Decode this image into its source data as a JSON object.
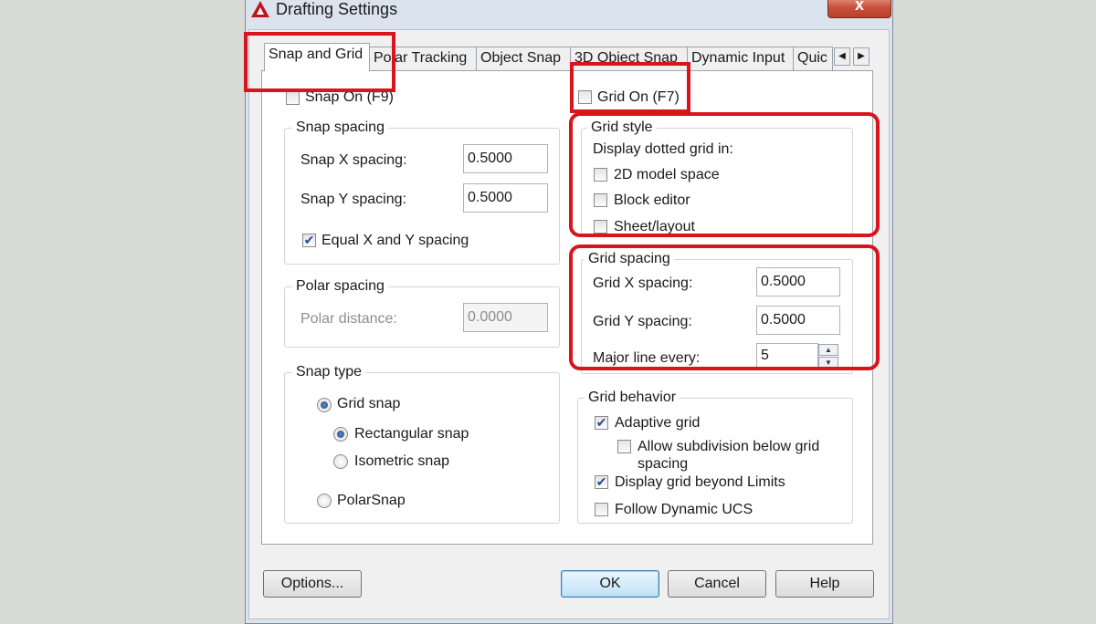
{
  "window": {
    "title": "Drafting Settings",
    "close_glyph": "x"
  },
  "tabs": [
    {
      "label": "Snap and Grid",
      "active": true
    },
    {
      "label": "Polar Tracking"
    },
    {
      "label": "Object Snap"
    },
    {
      "label": "3D Object Snap"
    },
    {
      "label": "Dynamic Input"
    },
    {
      "label": "Quic"
    }
  ],
  "tab_scroll": {
    "left_glyph": "◀",
    "right_glyph": "▶"
  },
  "snap_on": {
    "label": "Snap On (F9)",
    "checked": false
  },
  "grid_on": {
    "label": "Grid On (F7)",
    "checked": false
  },
  "snap_spacing": {
    "title": "Snap spacing",
    "x_label": "Snap X spacing:",
    "x_value": "0.5000",
    "y_label": "Snap Y spacing:",
    "y_value": "0.5000",
    "equal_label": "Equal X and Y spacing",
    "equal_checked": true
  },
  "polar_spacing": {
    "title": "Polar spacing",
    "distance_label": "Polar distance:",
    "distance_value": "0.0000"
  },
  "snap_type": {
    "title": "Snap type",
    "grid_snap": "Grid snap",
    "rectangular": "Rectangular snap",
    "isometric": "Isometric snap",
    "polarsnap": "PolarSnap"
  },
  "grid_style": {
    "title": "Grid style",
    "intro": "Display dotted grid in:",
    "model_space": "2D model space",
    "block_editor": "Block editor",
    "sheet_layout": "Sheet/layout"
  },
  "grid_spacing": {
    "title": "Grid spacing",
    "x_label": "Grid X spacing:",
    "x_value": "0.5000",
    "y_label": "Grid Y spacing:",
    "y_value": "0.5000",
    "major_label": "Major line every:",
    "major_value": "5",
    "spin_up": "▲",
    "spin_down": "▼"
  },
  "grid_behavior": {
    "title": "Grid behavior",
    "adaptive": "Adaptive grid",
    "adaptive_checked": true,
    "subdivision_1": "Allow subdivision below grid",
    "subdivision_2": "spacing",
    "beyond_limits": "Display grid beyond Limits",
    "beyond_checked": true,
    "follow_ucs": "Follow Dynamic UCS"
  },
  "buttons": {
    "options": "Options...",
    "ok": "OK",
    "cancel": "Cancel",
    "help": "Help"
  },
  "check_glyph": "✔",
  "colors": {
    "highlight": "#d8141c",
    "check": "#244b8f"
  }
}
